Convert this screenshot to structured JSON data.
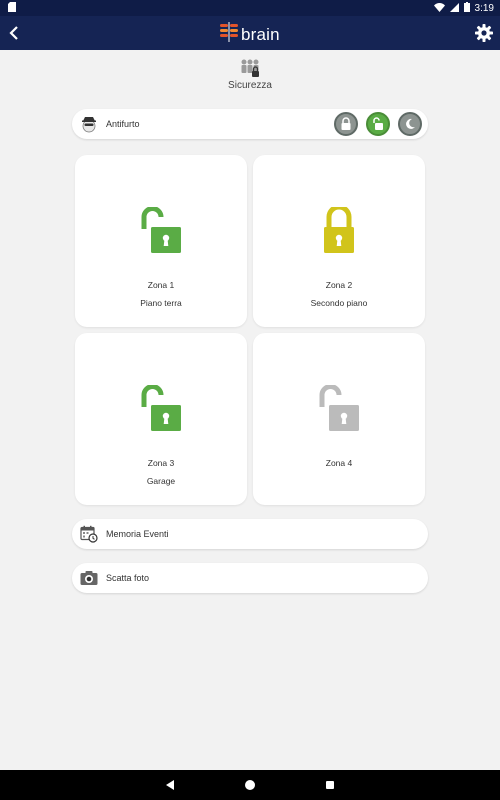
{
  "status_bar": {
    "time": "3:19"
  },
  "app_bar": {
    "brand": "brain"
  },
  "header": {
    "title": "Sicurezza"
  },
  "antifurto": {
    "label": "Antifurto",
    "active_mode": "unlocked"
  },
  "zones": [
    {
      "name": "Zona 1",
      "subtitle": "Piano terra",
      "state": "open",
      "color": "#5aac45"
    },
    {
      "name": "Zona 2",
      "subtitle": "Secondo piano",
      "state": "open",
      "color": "#d1c41b"
    },
    {
      "name": "Zona 3",
      "subtitle": "Garage",
      "state": "open",
      "color": "#5aac45"
    },
    {
      "name": "Zona 4",
      "subtitle": "",
      "state": "open",
      "color": "#bbbbbb"
    }
  ],
  "menu": {
    "memoria_eventi": "Memoria Eventi",
    "scatta_foto": "Scatta foto"
  },
  "colors": {
    "app_bar": "#152454",
    "status_bar": "#0f1c47",
    "accent_green": "#5aac45",
    "accent_yellow": "#d1c41b",
    "disabled_gray": "#bbbbbb"
  }
}
